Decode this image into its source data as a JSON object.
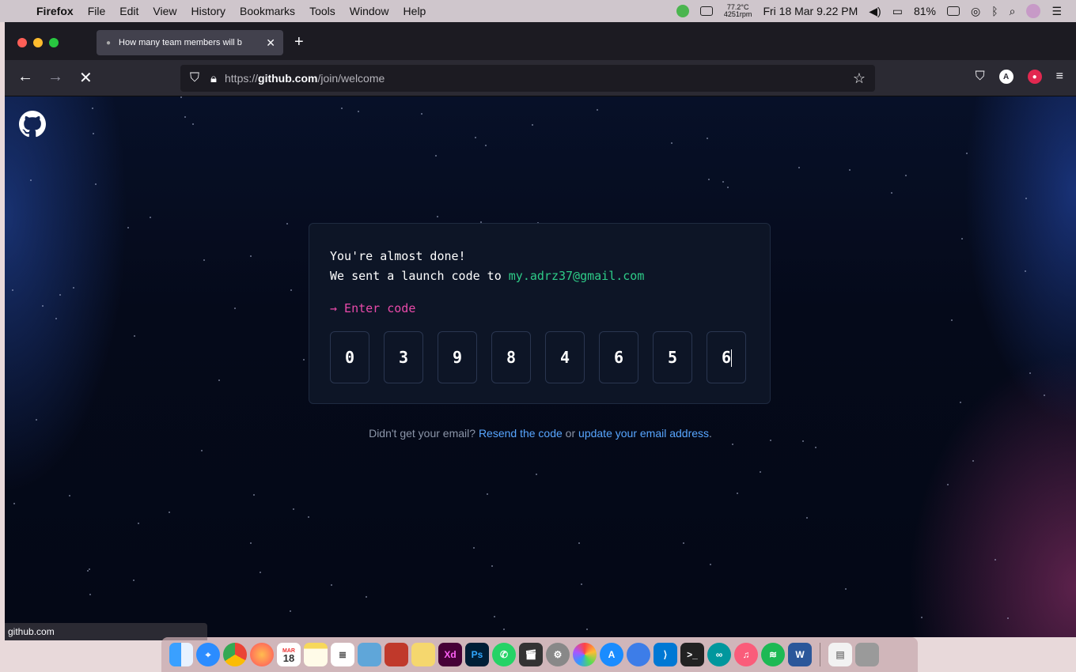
{
  "menubar": {
    "app": "Firefox",
    "menus": [
      "File",
      "Edit",
      "View",
      "History",
      "Bookmarks",
      "Tools",
      "Window",
      "Help"
    ],
    "temp_line1": "77.2°C",
    "temp_line2": "4251rpm",
    "datetime": "Fri 18 Mar  9.22 PM",
    "battery": "81%"
  },
  "browser": {
    "tab_title": "How many team members will b",
    "url_prefix": "https://",
    "url_host": "github.com",
    "url_path": "/join/welcome",
    "status_url": "github.com"
  },
  "page": {
    "line1": "You're almost done!",
    "line2_prefix": "We sent a launch code to ",
    "email": "my.adrz37@gmail.com",
    "prompt": "→ Enter code",
    "code_digits": [
      "0",
      "3",
      "9",
      "8",
      "4",
      "6",
      "5",
      "6"
    ],
    "help_prefix": "Didn't get your email? ",
    "resend_link": "Resend the code",
    "help_middle": " or ",
    "update_link": "update your email address",
    "help_suffix": "."
  },
  "dock": {
    "icons": [
      "finder-icon",
      "safari-icon",
      "chrome-icon",
      "firefox-icon",
      "calendar-icon",
      "notes-icon",
      "reminders-icon",
      "preview-icon",
      "photobooth-icon",
      "stickies-icon",
      "xd-icon",
      "photoshop-icon",
      "whatsapp-icon",
      "finalcut-icon",
      "system-preferences-icon",
      "photos-icon",
      "appstore-icon",
      "edge-icon",
      "vscode-icon",
      "terminal-icon",
      "arduino-icon",
      "music-icon",
      "spotify-icon",
      "word-icon",
      "document-icon",
      "trash-icon"
    ],
    "calendar_day": "18",
    "calendar_month": "MAR"
  }
}
